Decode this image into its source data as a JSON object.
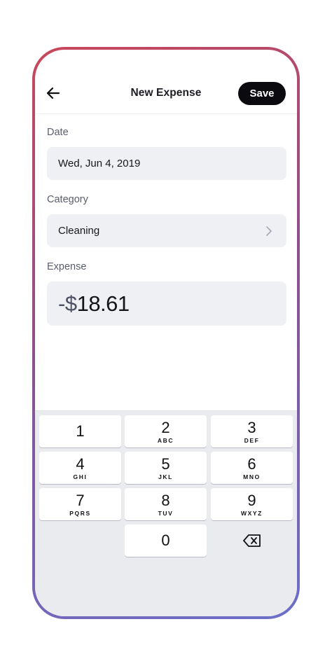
{
  "header": {
    "title": "New Expense",
    "save_label": "Save",
    "back_icon": "arrow-left-icon"
  },
  "form": {
    "date": {
      "label": "Date",
      "value": "Wed, Jun 4, 2019"
    },
    "category": {
      "label": "Category",
      "value": "Cleaning",
      "icon": "chevron-right-icon"
    },
    "expense": {
      "label": "Expense",
      "prefix": "-$",
      "amount": "18.61"
    }
  },
  "keypad": {
    "keys": [
      {
        "digit": "1",
        "letters": ""
      },
      {
        "digit": "2",
        "letters": "ABC"
      },
      {
        "digit": "3",
        "letters": "DEF"
      },
      {
        "digit": "4",
        "letters": "GHI"
      },
      {
        "digit": "5",
        "letters": "JKL"
      },
      {
        "digit": "6",
        "letters": "MNO"
      },
      {
        "digit": "7",
        "letters": "PQRS"
      },
      {
        "digit": "8",
        "letters": "TUV"
      },
      {
        "digit": "9",
        "letters": "WXYZ"
      },
      {
        "digit": "0",
        "letters": ""
      }
    ],
    "delete_icon": "backspace-icon"
  },
  "colors": {
    "frame_gradient_start": "#c9485b",
    "frame_gradient_end": "#6b6fc9",
    "field_background": "#eef0f3",
    "keypad_background": "#eaebef",
    "save_button": "#0b0b0f"
  }
}
